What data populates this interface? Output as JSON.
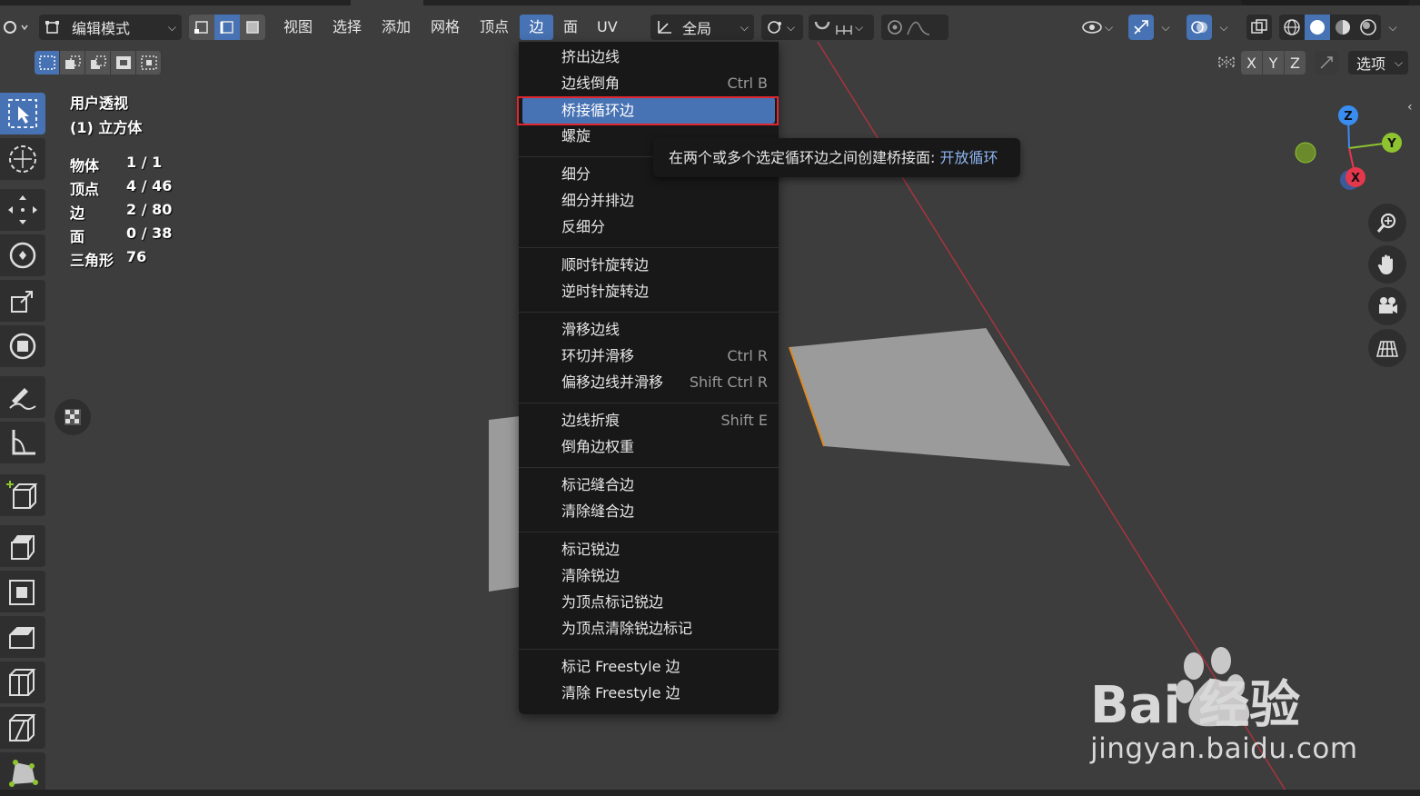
{
  "header": {
    "mode_label": "编辑模式",
    "menus": [
      "视图",
      "选择",
      "添加",
      "网格",
      "顶点",
      "边",
      "面",
      "UV"
    ],
    "active_menu": "边",
    "orientation_label": "全局",
    "options_label": "选项",
    "axis": [
      "X",
      "Y",
      "Z"
    ]
  },
  "overlay": {
    "view_name": "用户透视",
    "object_name": "(1) 立方体",
    "stats": [
      {
        "label": "物体",
        "value": "1 / 1"
      },
      {
        "label": "顶点",
        "value": "4 / 46"
      },
      {
        "label": "边",
        "value": "2 / 80"
      },
      {
        "label": "面",
        "value": "0 / 38"
      },
      {
        "label": "三角形",
        "value": "76"
      }
    ]
  },
  "edge_menu": {
    "items": [
      {
        "label": "挤出边线",
        "shortcut": ""
      },
      {
        "label": "边线倒角",
        "shortcut": "Ctrl B"
      },
      {
        "label": "桥接循环边",
        "shortcut": "",
        "highlighted": true
      },
      {
        "label": "螺旋",
        "shortcut": ""
      },
      {
        "label": "细分",
        "shortcut": ""
      },
      {
        "label": "细分并排边",
        "shortcut": ""
      },
      {
        "label": "反细分",
        "shortcut": ""
      },
      {
        "label": "顺时针旋转边",
        "shortcut": ""
      },
      {
        "label": "逆时针旋转边",
        "shortcut": ""
      },
      {
        "label": "滑移边线",
        "shortcut": ""
      },
      {
        "label": "环切并滑移",
        "shortcut": "Ctrl R"
      },
      {
        "label": "偏移边线并滑移",
        "shortcut": "Shift Ctrl R"
      },
      {
        "label": "边线折痕",
        "shortcut": "Shift E"
      },
      {
        "label": "倒角边权重",
        "shortcut": ""
      },
      {
        "label": "标记缝合边",
        "shortcut": ""
      },
      {
        "label": "清除缝合边",
        "shortcut": ""
      },
      {
        "label": "标记锐边",
        "shortcut": ""
      },
      {
        "label": "清除锐边",
        "shortcut": ""
      },
      {
        "label": "为顶点标记锐边",
        "shortcut": ""
      },
      {
        "label": "为顶点清除锐边标记",
        "shortcut": ""
      },
      {
        "label": "标记 Freestyle 边",
        "shortcut": ""
      },
      {
        "label": "清除 Freestyle 边",
        "shortcut": ""
      }
    ]
  },
  "tooltip": {
    "text": "在两个或多个选定循环边之间创建桥接面:",
    "python": "开放循环"
  },
  "gizmo": {
    "x": "X",
    "y": "Y",
    "z": "Z"
  },
  "watermark": {
    "text": "jingyan.baidu.com",
    "logo_text": "Bai 经验"
  },
  "colors": {
    "accent": "#4772b3",
    "background": "#3d3d3d",
    "menu_bg": "#181818",
    "highlight_box": "#e0262f",
    "axis_x": "#e5374c",
    "axis_y": "#8ec42f",
    "axis_z": "#3a8df0"
  }
}
